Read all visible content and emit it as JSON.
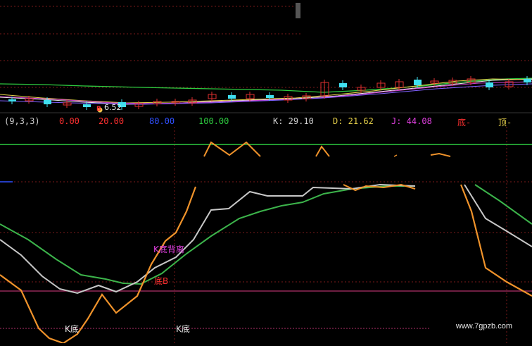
{
  "indicator": {
    "params": "(9,3,3)",
    "level1": "0.00",
    "level2": "20.00",
    "level3": "80.00",
    "level4": "100.00",
    "k_text": "K: 29.10",
    "d_text": "D: 21.62",
    "j_text": "J: 44.08",
    "bottom_text": "底-",
    "top_text": "顶-"
  },
  "annotations": {
    "buy_marker": "B",
    "price_label": "6.52",
    "divergence_label": "K底背离",
    "bottom_b_label": "底B",
    "k_bottom_1": "K底",
    "k_bottom_2": "K底"
  },
  "watermark": "www.7gpzb.com",
  "colors": {
    "background": "#000000",
    "k_line": "#c8c8c8",
    "d_line": "#3cb44b",
    "j_line": "#f0932b",
    "level_line": "#b0306a",
    "green_ma": "#2ecc40",
    "up_candle": "#e03030",
    "down_candle": "#40e0f0",
    "grid": "#7a1a1a"
  }
}
